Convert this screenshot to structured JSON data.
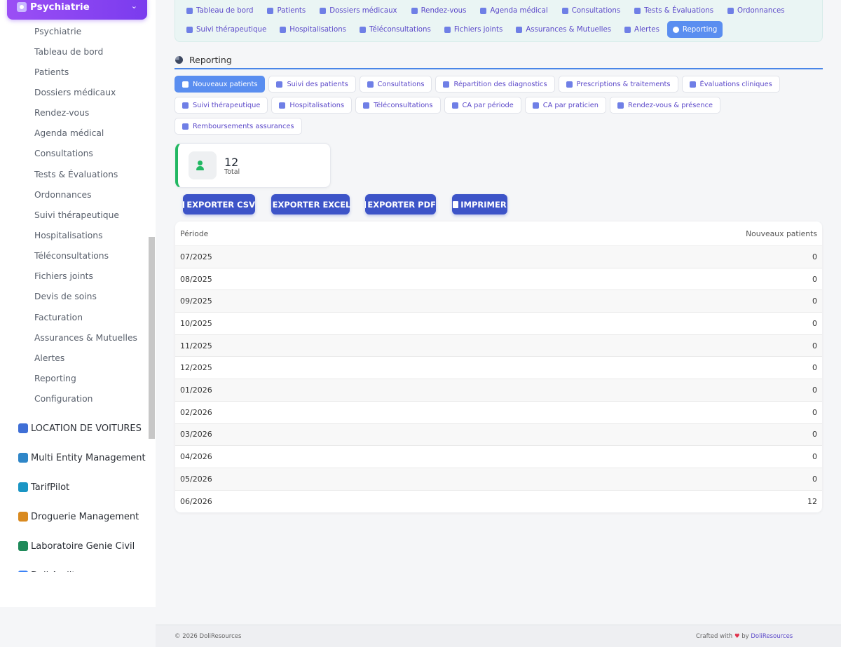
{
  "sidebar": {
    "module": {
      "label": "Psychiatrie"
    },
    "items": [
      "Psychiatrie",
      "Tableau de bord",
      "Patients",
      "Dossiers médicaux",
      "Rendez-vous",
      "Agenda médical",
      "Consultations",
      "Tests & Évaluations",
      "Ordonnances",
      "Suivi thérapeutique",
      "Hospitalisations",
      "Téléconsultations",
      "Fichiers joints",
      "Devis de soins",
      "Facturation",
      "Assurances & Mutuelles",
      "Alertes",
      "Reporting",
      "Configuration"
    ],
    "modules": [
      {
        "label": "LOCATION DE VOITURES",
        "color": "#3f6fd6"
      },
      {
        "label": "Multi Entity Management",
        "color": "#2f86c8"
      },
      {
        "label": "TarifPilot",
        "color": "#1a95c4"
      },
      {
        "label": "Droguerie Management",
        "color": "#d98a20"
      },
      {
        "label": "Laboratoire Genie Civil",
        "color": "#1f8a5a"
      },
      {
        "label": "Doli Audit",
        "color": "#3b82f6"
      }
    ]
  },
  "topnav": {
    "row1": [
      "Tableau de bord",
      "Patients",
      "Dossiers médicaux",
      "Rendez-vous",
      "Agenda médical",
      "Consultations",
      "Tests & Évaluations",
      "Ordonnances"
    ],
    "row2": [
      "Suivi thérapeutique",
      "Hospitalisations",
      "Téléconsultations",
      "Fichiers joints",
      "Assurances & Mutuelles",
      "Alertes",
      "Reporting"
    ],
    "active": "Reporting"
  },
  "section": {
    "title": "Reporting"
  },
  "tabs": {
    "row1": [
      "Nouveaux patients",
      "Suivi des patients",
      "Consultations",
      "Répartition des diagnostics",
      "Prescriptions & traitements",
      "Évaluations cliniques"
    ],
    "row2": [
      "Suivi thérapeutique",
      "Hospitalisations",
      "Téléconsultations",
      "CA par période",
      "CA par praticien",
      "Rendez-vous & présence"
    ],
    "row3": [
      "Remboursements assurances"
    ],
    "active": "Nouveaux patients"
  },
  "stat": {
    "value": "12",
    "label": "Total"
  },
  "export": {
    "csv": "EXPORTER CSV",
    "excel": "EXPORTER EXCEL",
    "pdf": "EXPORTER PDF",
    "print": "IMPRIMER"
  },
  "table": {
    "headers": {
      "period": "Période",
      "new_patients": "Nouveaux patients"
    },
    "rows": [
      {
        "period": "07/2025",
        "value": "0"
      },
      {
        "period": "08/2025",
        "value": "0"
      },
      {
        "period": "09/2025",
        "value": "0"
      },
      {
        "period": "10/2025",
        "value": "0"
      },
      {
        "period": "11/2025",
        "value": "0"
      },
      {
        "period": "12/2025",
        "value": "0"
      },
      {
        "period": "01/2026",
        "value": "0"
      },
      {
        "period": "02/2026",
        "value": "0"
      },
      {
        "period": "03/2026",
        "value": "0"
      },
      {
        "period": "04/2026",
        "value": "0"
      },
      {
        "period": "05/2026",
        "value": "0"
      },
      {
        "period": "06/2026",
        "value": "12"
      }
    ]
  },
  "footer": {
    "copyright": "© 2026 DoliResources",
    "crafted": "Crafted with",
    "heart": "♥",
    "by": "by",
    "brand": "DoliResources"
  }
}
